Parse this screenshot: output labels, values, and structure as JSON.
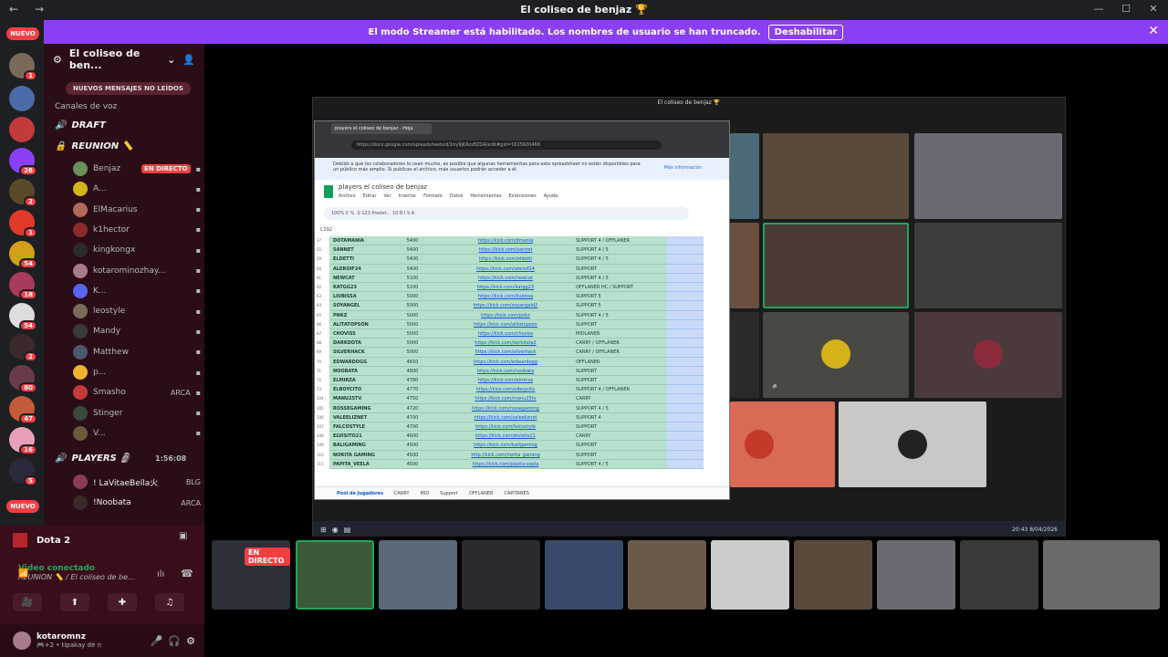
{
  "window": {
    "title": "El coliseo de benjaz 🏆",
    "nav_back": "←",
    "nav_forward": "→",
    "controls": [
      "—",
      "☐",
      "✕"
    ]
  },
  "banner": {
    "text": "El modo Streamer está habilitado. Los nombres de usuario se han truncado.",
    "button": "Deshabilitar",
    "close": "✕"
  },
  "guilds": {
    "nuevo_top": "NUEVO",
    "nuevo_bottom": "NUEVO",
    "badges": [
      "1",
      "26",
      "2",
      "1",
      "54",
      "18",
      "54",
      "2",
      "80",
      "47",
      "16",
      "5"
    ]
  },
  "server": {
    "name": "El coliseo de ben...",
    "new_messages": "NUEVOS MENSAJES NO LEÍDOS",
    "category": "Canales de voz",
    "channels": [
      "DRAFT",
      "REUNION 📏"
    ],
    "players_channel": "PLAYERS 🗿",
    "players_time": "1:56:08"
  },
  "members": [
    {
      "name": "Benjaz",
      "tag": "EN DIRECTO",
      "color": "#6b8f5a"
    },
    {
      "name": "A...",
      "color": "#d4b21a"
    },
    {
      "name": "ElMacarius",
      "color": "#b06a5a"
    },
    {
      "name": "k1hector",
      "color": "#8b2b2b"
    },
    {
      "name": "kingkongx",
      "color": "#2b2b2b"
    },
    {
      "name": "kotarominozhay...",
      "color": "#a87b8e"
    },
    {
      "name": "K...",
      "color": "#5865f2"
    },
    {
      "name": "leostyle",
      "color": "#7a6a5a"
    },
    {
      "name": "Mandy",
      "color": "#3a3a3a"
    },
    {
      "name": "Matthew",
      "color": "#4a5a6a"
    },
    {
      "name": "p...",
      "color": "#f0b232"
    },
    {
      "name": "Smasho",
      "tag": "ARCA",
      "color": "#c43a3a"
    },
    {
      "name": "Stinger",
      "color": "#3a4a3a"
    },
    {
      "name": "V...",
      "color": "#6a5a3a"
    }
  ],
  "players": [
    {
      "name": "! LaVitaeBella火",
      "tag": "BLG"
    },
    {
      "name": "!Noobata",
      "tag": "ARCA"
    }
  ],
  "voice": {
    "game": "Dota 2",
    "status": "Video conectado",
    "channel_path": "REUNION 📏 / El coliseo de be...",
    "username": "kotaromnz",
    "user_sub": "🎮+2 • tipakay de n"
  },
  "stream": {
    "window_title": "El coliseo de benjaz 🏆",
    "live_label": "EN DIRECTO",
    "clock": "20:43\n8/04/2026"
  },
  "sheet": {
    "tab_title": "players el coliseo de benjaz - Hoja",
    "url": "https://docs.google.com/spreadsheets/d/1hy9jKRzz8ZOA/edit#gid=1615600466",
    "info": "Debido a que los colaboradores lo usan mucho, es posible que algunas herramientas para este spreadsheet no estén disponibles para un público más amplio. Si publicas el archivo, más usuarios podrán acceder a él.",
    "info_more": "Más información",
    "title": "players el coliseo de benjaz",
    "menu": [
      "Archivo",
      "Editar",
      "Ver",
      "Insertar",
      "Formato",
      "Datos",
      "Herramientas",
      "Extensiones",
      "Ayuda"
    ],
    "toolbar": "100%   €  %  .0  123   Predet...   10   B  I  S  A",
    "cell_ref": "C192",
    "tabs": [
      "Pool de Jugadores",
      "CARRY",
      "MID",
      "Support",
      "OFFLANER",
      "CAPITANES"
    ],
    "rows": [
      {
        "n": "37",
        "name": "DOTAMANIA",
        "mmr": "5400",
        "link": "https://kick.com/dmania",
        "role": "SUPPORT 4 / OFFLANER"
      },
      {
        "n": "55",
        "name": "SANNET",
        "mmr": "5400",
        "link": "https://kick.com/sannet",
        "role": "SUPPORT 4 / 5"
      },
      {
        "n": "59",
        "name": "ELDETTI",
        "mmr": "5400",
        "link": "https://kick.com/eldetti",
        "role": "SUPPORT 4 / 5"
      },
      {
        "n": "60",
        "name": "ALEROIF24",
        "mmr": "5400",
        "link": "https://kick.com/aleroif24",
        "role": "SUPPORT"
      },
      {
        "n": "61",
        "name": "NEWCAT",
        "mmr": "5100",
        "link": "https://kick.com/newcat",
        "role": "SUPPORT 4 / 5"
      },
      {
        "n": "62",
        "name": "KATGG23",
        "mmr": "5100",
        "link": "https://kick.com/katgg23",
        "role": "OFFLANER HC / SUPPORT"
      },
      {
        "n": "63",
        "name": "LIUBISSA",
        "mmr": "5000",
        "link": "https://kick.com/liubissa",
        "role": "SUPPORT 5"
      },
      {
        "n": "64",
        "name": "SOYANGEL",
        "mmr": "5000",
        "link": "https://kick.com/soyangeld2",
        "role": "SUPPORT 5"
      },
      {
        "n": "65",
        "name": "PNKZ",
        "mmr": "5000",
        "link": "https://kick.com/pnkz",
        "role": "SUPPORT 4 / 5"
      },
      {
        "n": "66",
        "name": "ALITATOPSON",
        "mmr": "5000",
        "link": "https://kick.com/alitatopson",
        "role": "SUPPORT"
      },
      {
        "n": "67",
        "name": "CHOVISS",
        "mmr": "5000",
        "link": "https://kick.com/choviss",
        "role": "MIDLANER"
      },
      {
        "n": "68",
        "name": "DARKDOTA",
        "mmr": "5000",
        "link": "https://kick.com/darkdota2",
        "role": "CARRY / OFFLANER"
      },
      {
        "n": "69",
        "name": "SILVERHACK",
        "mmr": "5000",
        "link": "https://kick.com/silverhack",
        "role": "CARRY / OFFLANER"
      },
      {
        "n": "70",
        "name": "EDWARDOGG",
        "mmr": "4810",
        "link": "https://kick.com/edwardogg",
        "role": "OFFLANER"
      },
      {
        "n": "71",
        "name": "NOOBATA",
        "mmr": "4800",
        "link": "https://kick.com/noobata",
        "role": "SUPPORT"
      },
      {
        "n": "72",
        "name": "ELMIRZA",
        "mmr": "4780",
        "link": "https://kick.com/elmirza",
        "role": "SUPPORT"
      },
      {
        "n": "73",
        "name": "ELBOYCITO",
        "mmr": "4770",
        "link": "https://kick.com/elboycito",
        "role": "SUPPORT 4 / OFFLANER"
      },
      {
        "n": "104",
        "name": "MANU25TV",
        "mmr": "4750",
        "link": "https://kick.com/manu25tv",
        "role": "CARRY"
      },
      {
        "n": "105",
        "name": "ROSSEGAMING",
        "mmr": "4720",
        "link": "https://kick.com/rossegaming",
        "role": "SUPPORT 4 / 5"
      },
      {
        "n": "106",
        "name": "VALEELIZNET",
        "mmr": "4700",
        "link": "https://kick.com/valeeliznet",
        "role": "SUPPORT 4"
      },
      {
        "n": "107",
        "name": "FALCOSTYLE",
        "mmr": "4700",
        "link": "https://kick.com/falcostyle",
        "role": "SUPPORT"
      },
      {
        "n": "108",
        "name": "ELVISITO21",
        "mmr": "4600",
        "link": "https://kick.com/elvisito21",
        "role": "CARRY"
      },
      {
        "n": "109",
        "name": "BALIGAMING",
        "mmr": "4500",
        "link": "https://kick.com/baligaming",
        "role": "SUPPORT"
      },
      {
        "n": "110",
        "name": "NORITA GAMING",
        "mmr": "4500",
        "link": "http://kick.com/norita_gaming",
        "role": "SUPPORT"
      },
      {
        "n": "111",
        "name": "PAPITA_VEELA",
        "mmr": "4500",
        "link": "https://kick.com/papita-veela",
        "role": "SUPPORT 4 / 5"
      }
    ]
  },
  "colors": {
    "accent": "#8b3ff4",
    "live": "#f23f43",
    "speaking": "#23a55a"
  }
}
